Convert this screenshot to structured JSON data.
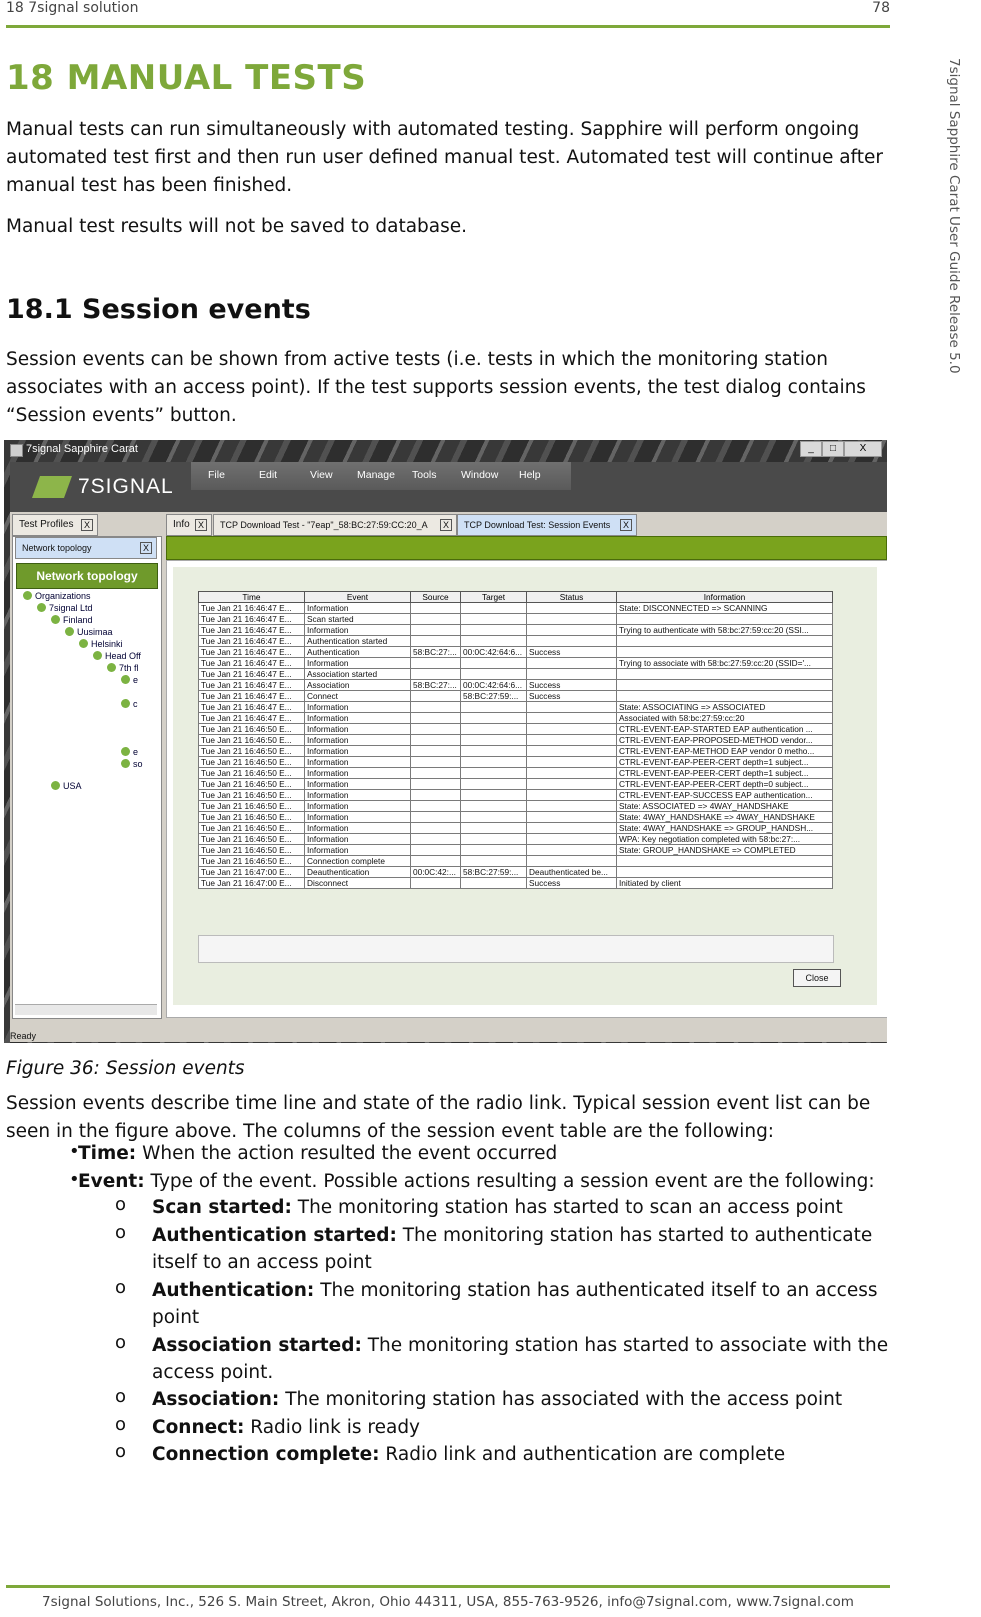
{
  "header": {
    "left": "18 7signal solution",
    "right": "78"
  },
  "sidebar_text": "7signal Sapphire Carat User Guide Release 5.0",
  "h1": "18 MANUAL TESTS",
  "p1": "Manual tests can run simultaneously with automated testing. Sapphire will perform ongoing automated test first and then run user defined manual test. Automated test will continue after manual test has been finished.",
  "p2": "Manual test results will not be saved to database.",
  "h2": "18.1 Session events",
  "p3": "Session events can be shown from active tests (i.e. tests in which the monitoring station associates with an access point). If the test supports session events, the test dialog contains “Session events” button.",
  "screenshot": {
    "window_title": "7signal Sapphire Carat",
    "window_buttons": [
      "_",
      "□",
      "X"
    ],
    "logo_text": "7SIGNAL",
    "menu": [
      "File",
      "Edit",
      "View",
      "Manage",
      "Tools",
      "Window",
      "Help"
    ],
    "left_tabs": {
      "test_profiles": "Test Profiles",
      "network_topology": "Network topology",
      "close": "X"
    },
    "network_button": "Network topology",
    "tree": [
      "Organizations",
      "7signal Ltd",
      "Finland",
      "Uusimaa",
      "Helsinki",
      "Head Off",
      "7th fl",
      "e",
      "c",
      "e",
      "so",
      "USA"
    ],
    "right_tabs": [
      "Info",
      "TCP Download Test - \"7eap\"_58:BC:27:59:CC:20_A",
      "TCP Download Test: Session Events"
    ],
    "columns": [
      "Time",
      "Event",
      "Source",
      "Target",
      "Status",
      "Information"
    ],
    "rows": [
      [
        "Tue Jan 21 16:46:47 E...",
        "Information",
        "",
        "",
        "",
        "State: DISCONNECTED => SCANNING"
      ],
      [
        "Tue Jan 21 16:46:47 E...",
        "Scan started",
        "",
        "",
        "",
        ""
      ],
      [
        "Tue Jan 21 16:46:47 E...",
        "Information",
        "",
        "",
        "",
        "Trying to authenticate with 58:bc:27:59:cc:20 (SSI..."
      ],
      [
        "Tue Jan 21 16:46:47 E...",
        "Authentication started",
        "",
        "",
        "",
        ""
      ],
      [
        "Tue Jan 21 16:46:47 E...",
        "Authentication",
        "58:BC:27:...",
        "00:0C:42:64:6...",
        "Success",
        ""
      ],
      [
        "Tue Jan 21 16:46:47 E...",
        "Information",
        "",
        "",
        "",
        "Trying to associate with 58:bc:27:59:cc:20 (SSID='..."
      ],
      [
        "Tue Jan 21 16:46:47 E...",
        "Association started",
        "",
        "",
        "",
        ""
      ],
      [
        "Tue Jan 21 16:46:47 E...",
        "Association",
        "58:BC:27:...",
        "00:0C:42:64:6...",
        "Success",
        ""
      ],
      [
        "Tue Jan 21 16:46:47 E...",
        "Connect",
        "",
        "58:BC:27:59:...",
        "Success",
        ""
      ],
      [
        "Tue Jan 21 16:46:47 E...",
        "Information",
        "",
        "",
        "",
        "State: ASSOCIATING => ASSOCIATED"
      ],
      [
        "Tue Jan 21 16:46:47 E...",
        "Information",
        "",
        "",
        "",
        "Associated with 58:bc:27:59:cc:20"
      ],
      [
        "Tue Jan 21 16:46:50 E...",
        "Information",
        "",
        "",
        "",
        "CTRL-EVENT-EAP-STARTED EAP authentication ..."
      ],
      [
        "Tue Jan 21 16:46:50 E...",
        "Information",
        "",
        "",
        "",
        "CTRL-EVENT-EAP-PROPOSED-METHOD vendor..."
      ],
      [
        "Tue Jan 21 16:46:50 E...",
        "Information",
        "",
        "",
        "",
        "CTRL-EVENT-EAP-METHOD EAP vendor 0 metho..."
      ],
      [
        "Tue Jan 21 16:46:50 E...",
        "Information",
        "",
        "",
        "",
        "CTRL-EVENT-EAP-PEER-CERT depth=1 subject..."
      ],
      [
        "Tue Jan 21 16:46:50 E...",
        "Information",
        "",
        "",
        "",
        "CTRL-EVENT-EAP-PEER-CERT depth=1 subject..."
      ],
      [
        "Tue Jan 21 16:46:50 E...",
        "Information",
        "",
        "",
        "",
        "CTRL-EVENT-EAP-PEER-CERT depth=0 subject..."
      ],
      [
        "Tue Jan 21 16:46:50 E...",
        "Information",
        "",
        "",
        "",
        "CTRL-EVENT-EAP-SUCCESS EAP authentication..."
      ],
      [
        "Tue Jan 21 16:46:50 E...",
        "Information",
        "",
        "",
        "",
        "State: ASSOCIATED => 4WAY_HANDSHAKE"
      ],
      [
        "Tue Jan 21 16:46:50 E...",
        "Information",
        "",
        "",
        "",
        "State: 4WAY_HANDSHAKE => 4WAY_HANDSHAKE"
      ],
      [
        "Tue Jan 21 16:46:50 E...",
        "Information",
        "",
        "",
        "",
        "State: 4WAY_HANDSHAKE => GROUP_HANDSH..."
      ],
      [
        "Tue Jan 21 16:46:50 E...",
        "Information",
        "",
        "",
        "",
        "WPA: Key negotiation completed with 58:bc:27:..."
      ],
      [
        "Tue Jan 21 16:46:50 E...",
        "Information",
        "",
        "",
        "",
        "State: GROUP_HANDSHAKE => COMPLETED"
      ],
      [
        "Tue Jan 21 16:46:50 E...",
        "Connection complete",
        "",
        "",
        "",
        ""
      ],
      [
        "Tue Jan 21 16:47:00 E...",
        "Deauthentication",
        "00:0C:42:...",
        "58:BC:27:59:...",
        "Deauthenticated be...",
        ""
      ],
      [
        "Tue Jan 21 16:47:00 E...",
        "Disconnect",
        "",
        "",
        "Success",
        "Initiated by client"
      ]
    ],
    "close_button": "Close",
    "status": "Ready"
  },
  "caption": "Figure 36: Session events",
  "p4": "Session events describe time line and state of the radio link. Typical session event list can be seen in the figure above. The columns of the session event table are the following:",
  "bullets": [
    {
      "term": "Time:",
      "text": " When the action resulted the event occurred"
    },
    {
      "term": "Event:",
      "text": " Type of the event. Possible actions resulting a session event are the following:"
    }
  ],
  "sub_bullets": [
    {
      "term": "Scan started:",
      "text": " The monitoring station has started to scan an access point"
    },
    {
      "term": "Authentication started:",
      "text": " The monitoring station has started to authenticate",
      "cont": "itself to an access point"
    },
    {
      "term": "Authentication:",
      "text": " The monitoring station has authenticated itself to an access",
      "cont": "point"
    },
    {
      "term": "Association started:",
      "text": " The monitoring station has started to associate with the",
      "cont": "access point."
    },
    {
      "term": "Association:",
      "text": " The monitoring station has associated with the access point"
    },
    {
      "term": "Connect:",
      "text": " Radio link is ready"
    },
    {
      "term": "Connection complete:",
      "text": " Radio link and authentication are complete"
    }
  ],
  "bullet_glyph": "•",
  "sub_bullet_glyph": "o",
  "footer": "7signal Solutions, Inc., 526 S. Main Street, Akron, Ohio 44311, USA, 855-763-9526, info@7signal.com, www.7signal.com"
}
